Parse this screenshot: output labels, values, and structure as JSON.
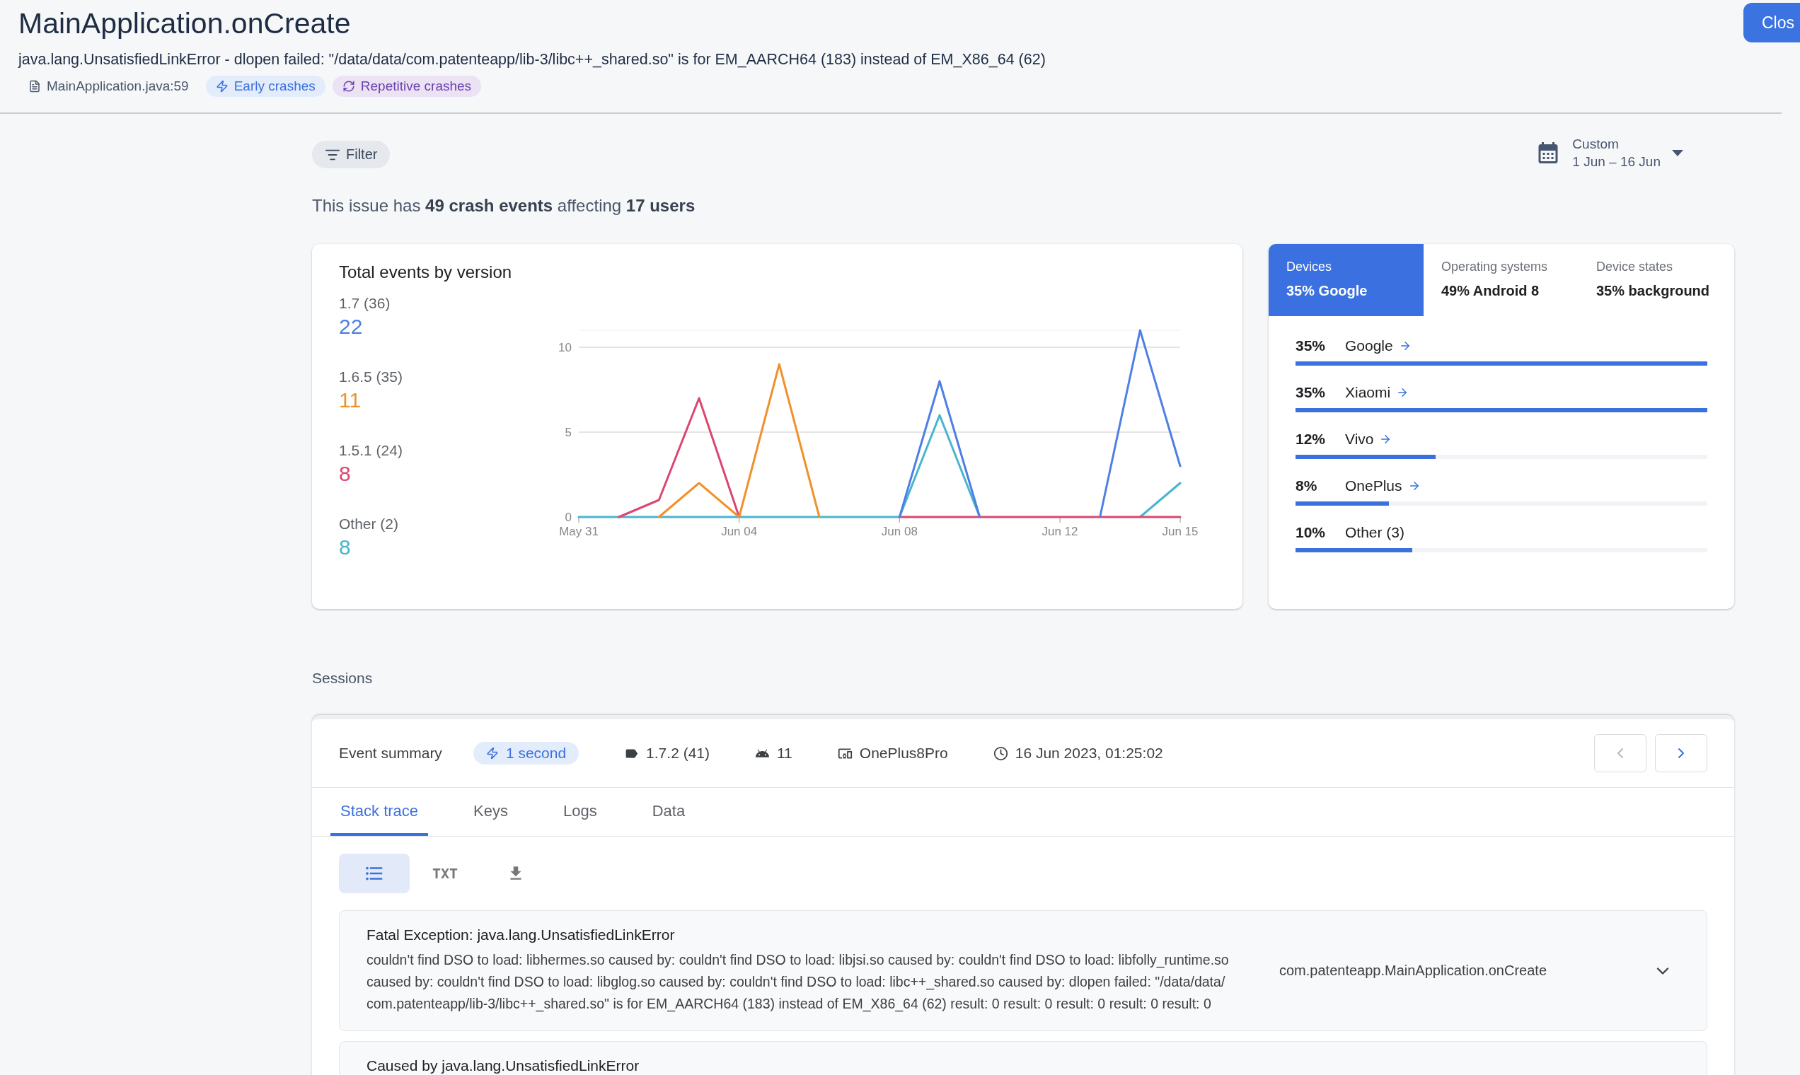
{
  "header": {
    "title": "MainApplication.onCreate",
    "subtitle": "java.lang.UnsatisfiedLinkError - dlopen failed: \"/data/data/com.patenteapp/lib-3/libc++_shared.so\" is for EM_AARCH64 (183) instead of EM_X86_64 (62)",
    "close_button": "Clos",
    "tags": [
      {
        "kind": "file",
        "label": "MainApplication.java:59"
      },
      {
        "kind": "early",
        "label": "Early crashes"
      },
      {
        "kind": "repetitive",
        "label": "Repetitive crashes"
      }
    ]
  },
  "filter_button": "Filter",
  "date_range": {
    "label": "Custom",
    "value": "1 Jun – 16 Jun"
  },
  "summary": "This issue has **49 crash events** affecting **17 users**",
  "events_chart": {
    "title": "Total events by version",
    "legend_totals": [
      "22",
      "11",
      "8",
      "8"
    ],
    "chart_data": {
      "type": "line",
      "categories": [
        "May 31",
        null,
        null,
        null,
        "Jun 04",
        null,
        null,
        null,
        "Jun 08",
        null,
        null,
        null,
        "Jun 12",
        null,
        null,
        "Jun 15"
      ],
      "ylim": [
        0,
        11
      ],
      "yticks": [
        0,
        5,
        10
      ],
      "series": [
        {
          "name": "1.7 (36)",
          "color": "#4f7fe6",
          "values": [
            null,
            null,
            null,
            null,
            null,
            null,
            null,
            null,
            0,
            8,
            0,
            null,
            null,
            0,
            11,
            3
          ]
        },
        {
          "name": "1.6.5 (35)",
          "color": "#ef922d",
          "values": [
            null,
            null,
            0,
            2,
            0,
            9,
            0,
            null,
            null,
            null,
            null,
            null,
            null,
            null,
            null,
            null
          ]
        },
        {
          "name": "1.5.1 (24)",
          "color": "#dc4670",
          "values": [
            null,
            0,
            1,
            7,
            0,
            null,
            null,
            null,
            0,
            0,
            0,
            0,
            0,
            0,
            0,
            0
          ]
        },
        {
          "name": "Other (2)",
          "color": "#47b5cf",
          "values": [
            0,
            0,
            0,
            0,
            0,
            0,
            0,
            0,
            0,
            6,
            0,
            null,
            null,
            null,
            0,
            2
          ]
        }
      ]
    }
  },
  "breakdown": {
    "tabs": [
      {
        "label": "Devices",
        "value": "35% Google",
        "selected": true
      },
      {
        "label": "Operating systems",
        "value": "49% Android 8",
        "selected": false
      },
      {
        "label": "Device states",
        "value": "35% background",
        "selected": false
      }
    ],
    "rows": [
      {
        "percent": "35%",
        "name": "Google",
        "link": true,
        "level": 1.0
      },
      {
        "percent": "35%",
        "name": "Xiaomi",
        "link": true,
        "level": 1.0
      },
      {
        "percent": "12%",
        "name": "Vivo",
        "link": true,
        "level": 0.34
      },
      {
        "percent": "8%",
        "name": "OnePlus",
        "link": true,
        "level": 0.227
      },
      {
        "percent": "10%",
        "name": "Other (3)",
        "link": false,
        "level": 0.284
      }
    ]
  },
  "sessions": {
    "label": "Sessions",
    "event_summary": "Event summary",
    "facts": [
      {
        "kind": "duration",
        "text": "1 second"
      },
      {
        "kind": "version",
        "text": "1.7.2 (41)"
      },
      {
        "kind": "android",
        "text": "11"
      },
      {
        "kind": "device",
        "text": "OnePlus8Pro"
      },
      {
        "kind": "time",
        "text": "16 Jun 2023, 01:25:02"
      }
    ],
    "prev_disabled": true,
    "next_disabled": false,
    "tabs": [
      {
        "label": "Stack trace",
        "selected": true
      },
      {
        "label": "Keys",
        "selected": false
      },
      {
        "label": "Logs",
        "selected": false
      },
      {
        "label": "Data",
        "selected": false
      }
    ],
    "views": [
      {
        "kind": "list",
        "selected": true
      },
      {
        "kind": "text",
        "label": "TXT",
        "selected": false
      },
      {
        "kind": "download",
        "selected": false
      }
    ],
    "frames": [
      {
        "title": "Fatal Exception: java.lang.UnsatisfiedLinkError",
        "message": "couldn't find DSO to load: libhermes.so caused by: couldn't find DSO to load: libjsi.so caused by: couldn't find DSO to load: libfolly_runtime.so caused by: couldn't find DSO to load: libglog.so caused by: couldn't find DSO to load: libc++_shared.so caused by: dlopen failed: \"/data/data/ com.patenteapp/lib-3/libc++_shared.so\" is for EM_AARCH64 (183) instead of EM_X86_64 (62) result: 0 result: 0 result: 0 result: 0 result: 0",
        "location": "com.patenteapp.MainApplication.onCreate",
        "expandable": true
      },
      {
        "title": "Caused by java.lang.UnsatisfiedLinkError"
      }
    ]
  }
}
